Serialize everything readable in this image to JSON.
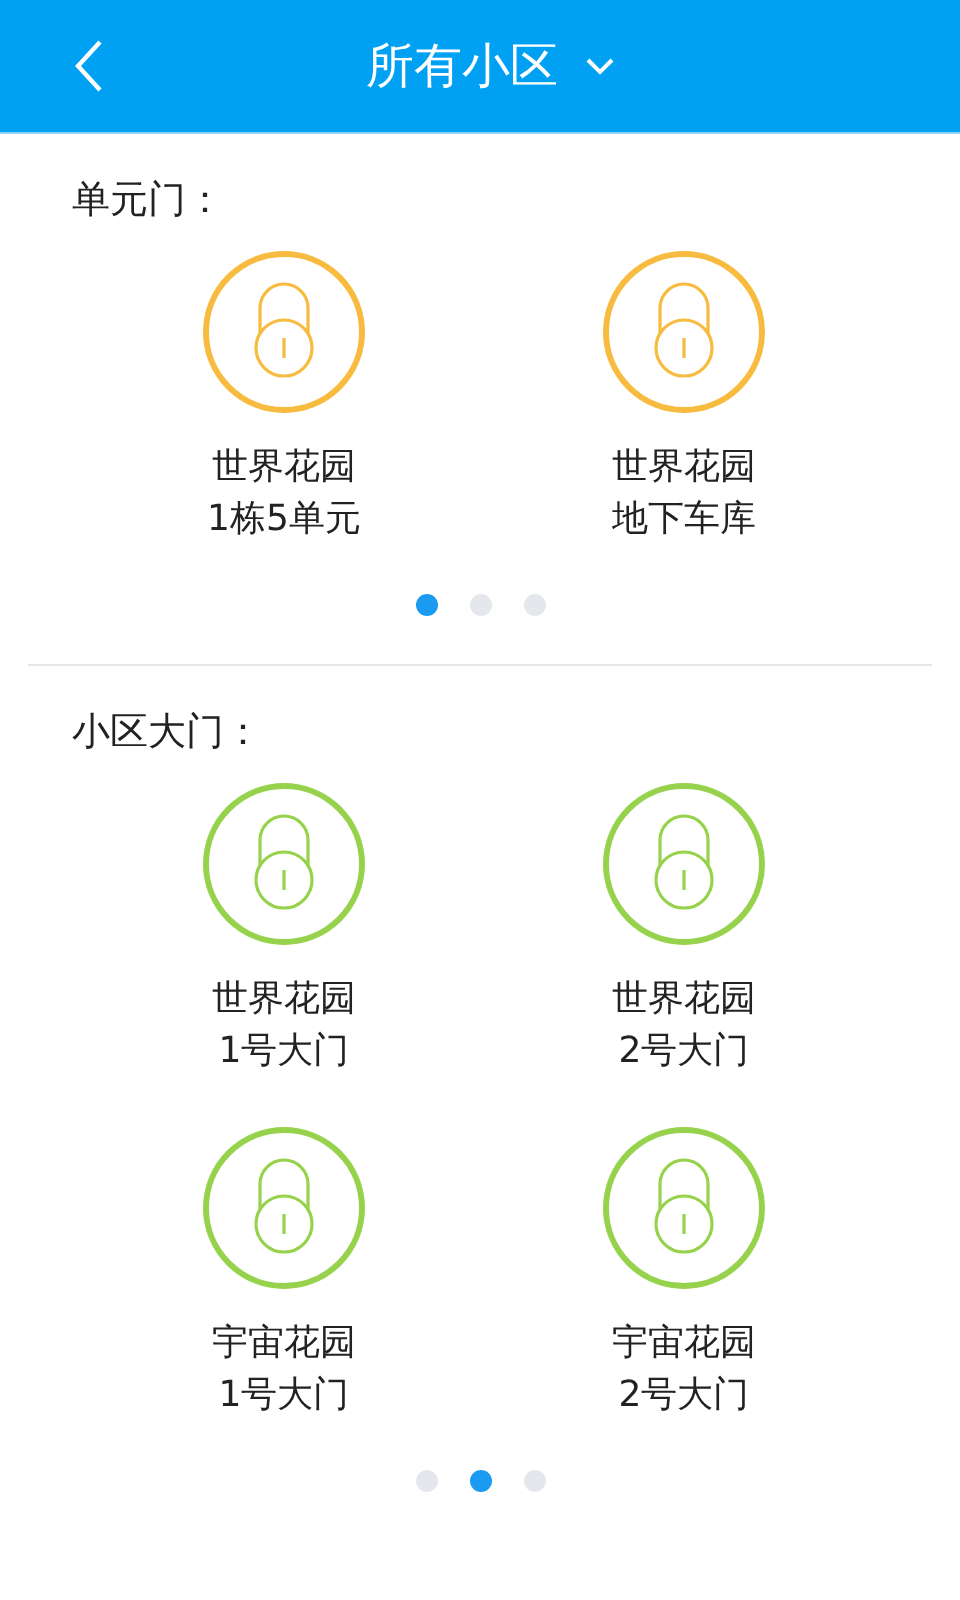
{
  "header": {
    "title": "所有小区"
  },
  "sections": [
    {
      "title": "单元门：",
      "doors": [
        {
          "name": "世界花园",
          "detail": "1栋5单元",
          "color": "#f6bb3f"
        },
        {
          "name": "世界花园",
          "detail": "地下车库",
          "color": "#f6bb3f"
        }
      ],
      "pages": [
        {
          "selected": true
        },
        {
          "selected": false
        },
        {
          "selected": false
        }
      ]
    },
    {
      "title": "小区大门：",
      "doors": [
        {
          "name": "世界花园",
          "detail": "1号大门",
          "color": "#97d24c"
        },
        {
          "name": "世界花园",
          "detail": "2号大门",
          "color": "#97d24c"
        },
        {
          "name": "宇宙花园",
          "detail": "1号大门",
          "color": "#97d24c"
        },
        {
          "name": "宇宙花园",
          "detail": "2号大门",
          "color": "#97d24c"
        }
      ],
      "pages": [
        {
          "selected": false
        },
        {
          "selected": true
        },
        {
          "selected": false
        }
      ]
    }
  ]
}
